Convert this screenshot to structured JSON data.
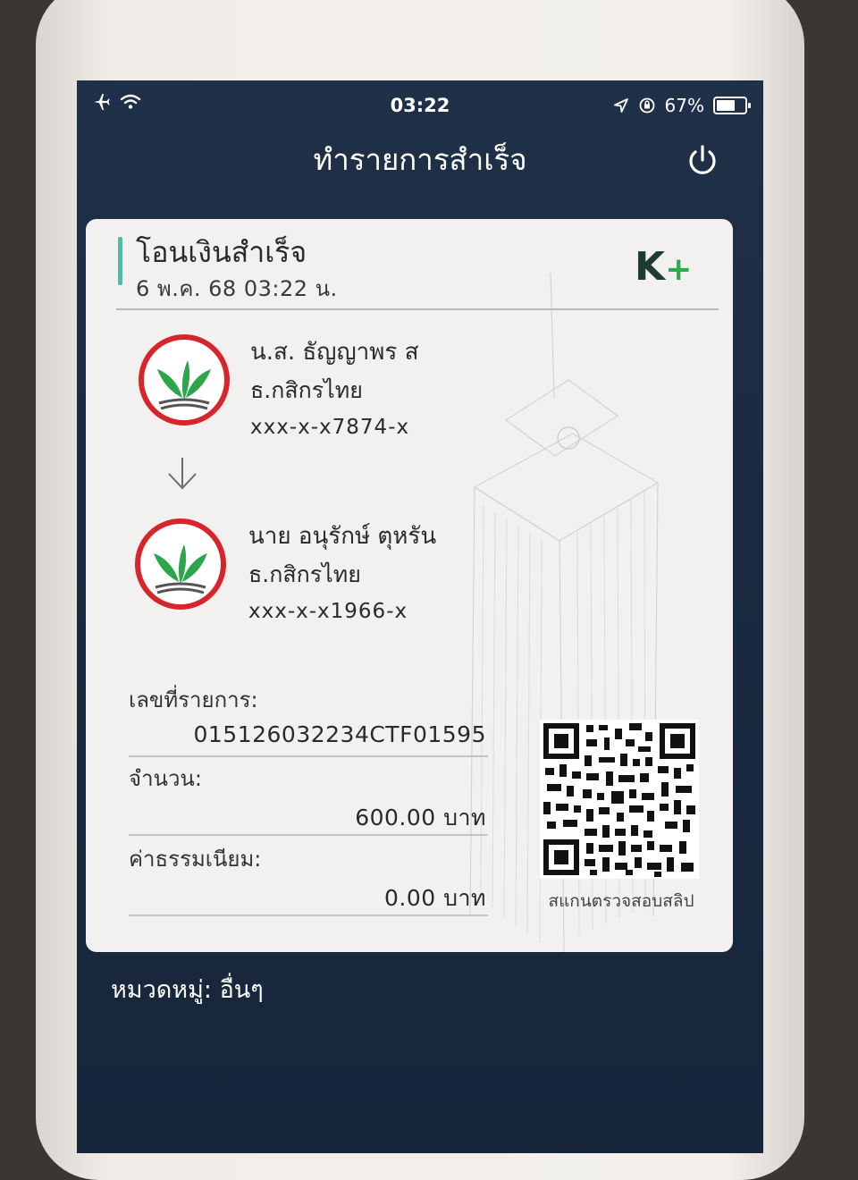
{
  "status_bar": {
    "time": "03:22",
    "battery": "67%",
    "battery_level": 0.67,
    "icons": [
      "airplane-icon",
      "wifi-icon",
      "location-icon",
      "orientation-lock-icon",
      "battery-icon"
    ]
  },
  "header": {
    "title": "ทำรายการสำเร็จ",
    "power_icon": "power-icon"
  },
  "slip": {
    "heading": "โอนเงินสำเร็จ",
    "datetime": "6 พ.ค. 68  03:22 น.",
    "logo_text": "K+",
    "sender": {
      "name": "น.ส. ธัญญาพร ส",
      "bank": "ธ.กสิกรไทย",
      "account": "xxx-x-x7874-x"
    },
    "receiver": {
      "name": "นาย อนุรักษ์  ตุหรัน",
      "bank": "ธ.กสิกรไทย",
      "account": "xxx-x-x1966-x"
    },
    "reference_label": "เลขที่รายการ:",
    "reference_value": "015126032234CTF01595",
    "amount_label": "จำนวน:",
    "amount_value": "600.00 บาท",
    "fee_label": "ค่าธรรมเนียม:",
    "fee_value": "0.00 บาท",
    "qr_caption": "สแกนตรวจสอบสลิป"
  },
  "category": "หมวดหมู่: อื่นๆ",
  "colors": {
    "accent": "#4ebda7",
    "kplus_dark": "#1d3a34",
    "kplus_green": "#2fa84f",
    "bank_red": "#d8242b",
    "bank_green": "#2ca54b",
    "screen_bg": "#1a2a40"
  }
}
